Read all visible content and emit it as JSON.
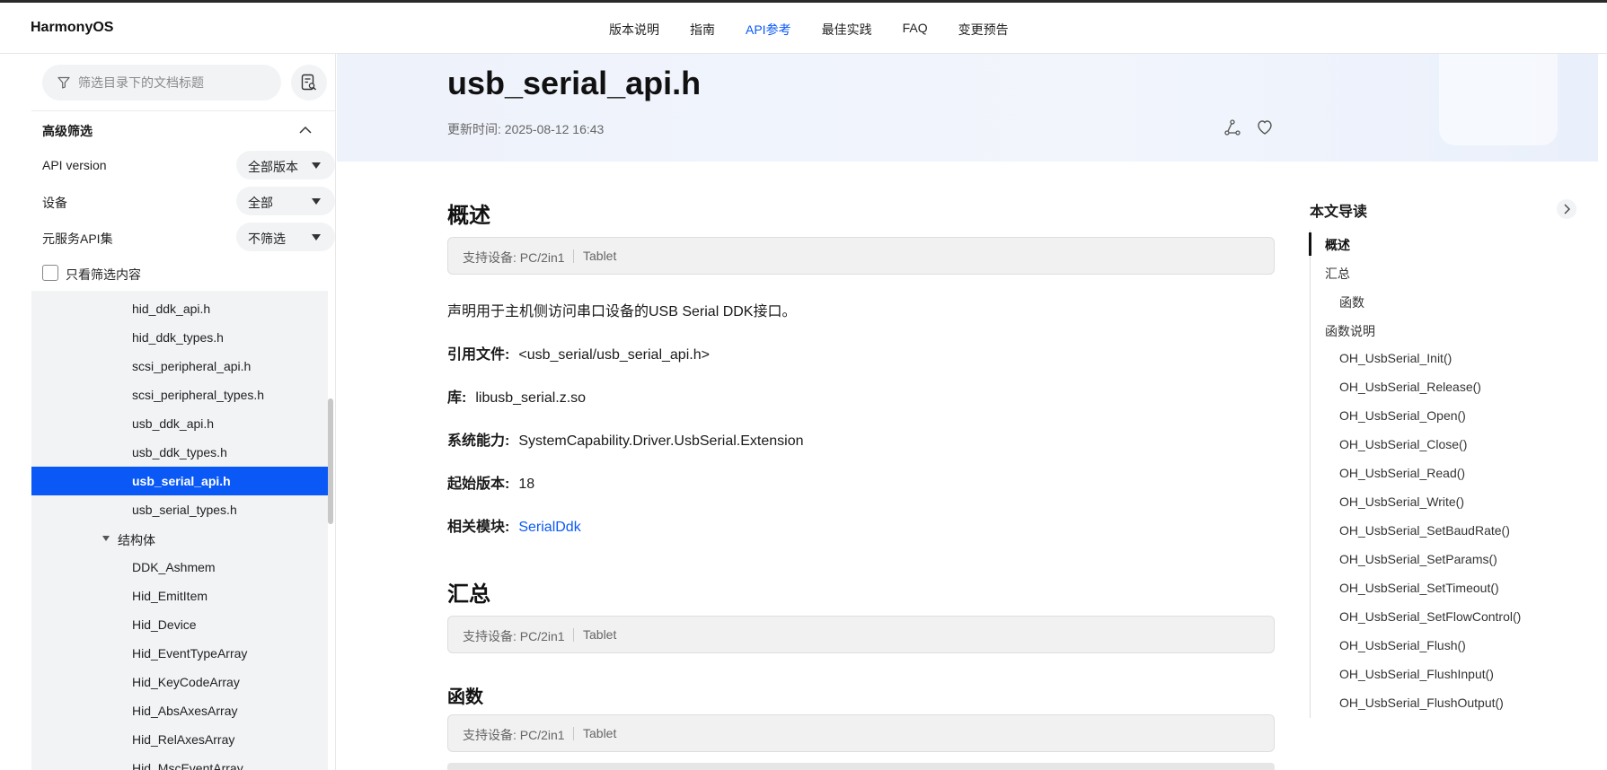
{
  "header": {
    "brand": "HarmonyOS",
    "nav": [
      {
        "label": "版本说明"
      },
      {
        "label": "指南"
      },
      {
        "label": "API参考",
        "active": true
      },
      {
        "label": "最佳实践"
      },
      {
        "label": "FAQ"
      },
      {
        "label": "变更预告"
      }
    ]
  },
  "sidebar": {
    "search_placeholder": "筛选目录下的文档标题",
    "advanced_filter_title": "高级筛选",
    "filters": [
      {
        "label": "API version",
        "value": "全部版本"
      },
      {
        "label": "设备",
        "value": "全部"
      },
      {
        "label": "元服务API集",
        "value": "不筛选"
      }
    ],
    "only_filtered_label": "只看筛选内容",
    "tree": [
      {
        "label": "hid_ddk_api.h"
      },
      {
        "label": "hid_ddk_types.h"
      },
      {
        "label": "scsi_peripheral_api.h"
      },
      {
        "label": "scsi_peripheral_types.h"
      },
      {
        "label": "usb_ddk_api.h"
      },
      {
        "label": "usb_ddk_types.h"
      },
      {
        "label": "usb_serial_api.h",
        "selected": true
      },
      {
        "label": "usb_serial_types.h"
      },
      {
        "label": "结构体",
        "group": true
      },
      {
        "label": "DDK_Ashmem"
      },
      {
        "label": "Hid_EmitItem"
      },
      {
        "label": "Hid_Device"
      },
      {
        "label": "Hid_EventTypeArray"
      },
      {
        "label": "Hid_KeyCodeArray"
      },
      {
        "label": "Hid_AbsAxesArray"
      },
      {
        "label": "Hid_RelAxesArray"
      },
      {
        "label": "Hid_MscEventArray"
      }
    ]
  },
  "main": {
    "title": "usb_serial_api.h",
    "update_time": "更新时间: 2025-08-12 16:43",
    "overview_heading": "概述",
    "devices": {
      "pc": "支持设备: PC/2in1",
      "tablet": "Tablet"
    },
    "description": "声明用于主机侧访问串口设备的USB Serial DDK接口。",
    "include_label": "引用文件:",
    "include_value": "<usb_serial/usb_serial_api.h>",
    "library_label": "库:",
    "library_value": "libusb_serial.z.so",
    "syscap_label": "系统能力:",
    "syscap_value": "SystemCapability.Driver.UsbSerial.Extension",
    "since_label": "起始版本:",
    "since_value": "18",
    "module_label": "相关模块:",
    "module_value": "SerialDdk",
    "summary_heading": "汇总",
    "functions_heading": "函数"
  },
  "toc": {
    "title": "本文导读",
    "items": [
      {
        "label": "概述",
        "level": 1,
        "active": true
      },
      {
        "label": "汇总",
        "level": 1
      },
      {
        "label": "函数",
        "level": 2
      },
      {
        "label": "函数说明",
        "level": 1
      },
      {
        "label": "OH_UsbSerial_Init()",
        "level": 2
      },
      {
        "label": "OH_UsbSerial_Release()",
        "level": 2
      },
      {
        "label": "OH_UsbSerial_Open()",
        "level": 2
      },
      {
        "label": "OH_UsbSerial_Close()",
        "level": 2
      },
      {
        "label": "OH_UsbSerial_Read()",
        "level": 2
      },
      {
        "label": "OH_UsbSerial_Write()",
        "level": 2
      },
      {
        "label": "OH_UsbSerial_SetBaudRate()",
        "level": 2
      },
      {
        "label": "OH_UsbSerial_SetParams()",
        "level": 2
      },
      {
        "label": "OH_UsbSerial_SetTimeout()",
        "level": 2
      },
      {
        "label": "OH_UsbSerial_SetFlowControl()",
        "level": 2
      },
      {
        "label": "OH_UsbSerial_Flush()",
        "level": 2
      },
      {
        "label": "OH_UsbSerial_FlushInput()",
        "level": 2
      },
      {
        "label": "OH_UsbSerial_FlushOutput()",
        "level": 2
      }
    ]
  },
  "colors": {
    "accent": "#0a59f7",
    "sidebar_bg": "#f1f3f5",
    "hero_bg": "#eef2fb"
  }
}
